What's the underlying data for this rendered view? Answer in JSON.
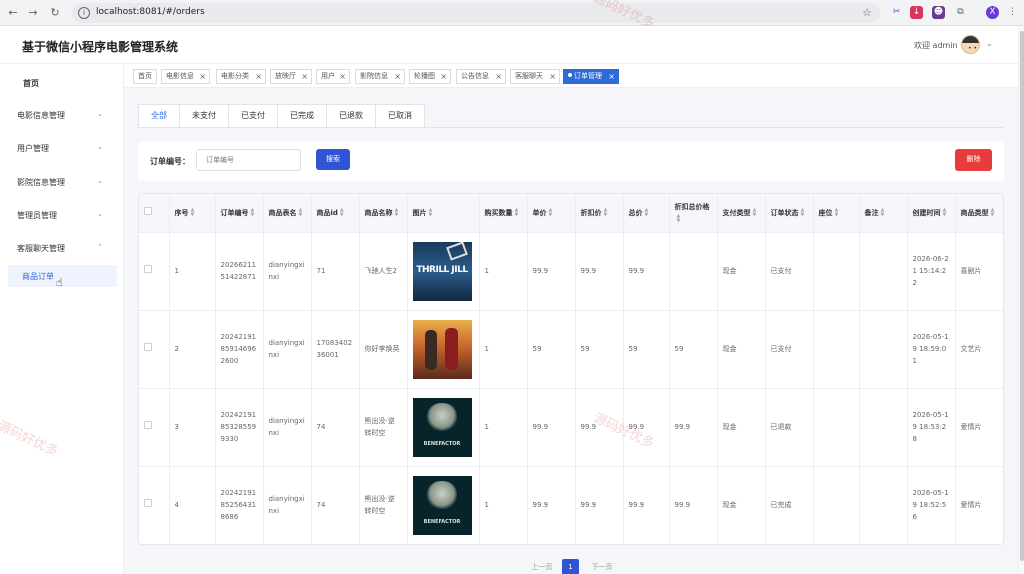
{
  "browser": {
    "url": "localhost:8081/#/orders",
    "profile_initial": "X"
  },
  "header": {
    "title": "基于微信小程序电影管理系统",
    "welcome": "欢迎 admin"
  },
  "sidebar": {
    "items": [
      {
        "label": "首页"
      },
      {
        "label": "电影信息管理"
      },
      {
        "label": "用户管理"
      },
      {
        "label": "影院信息管理"
      },
      {
        "label": "管理员管理"
      },
      {
        "label": "客服聊天管理"
      },
      {
        "label": "商品订单"
      }
    ]
  },
  "tags": [
    {
      "label": "首页"
    },
    {
      "label": "电影信息"
    },
    {
      "label": "电影分类"
    },
    {
      "label": "放映厅"
    },
    {
      "label": "用户"
    },
    {
      "label": "影院信息"
    },
    {
      "label": "轮播图"
    },
    {
      "label": "公告信息"
    },
    {
      "label": "客服聊天"
    },
    {
      "label": "订单管理"
    }
  ],
  "status_tabs": [
    {
      "label": "全部"
    },
    {
      "label": "未支付"
    },
    {
      "label": "已支付"
    },
    {
      "label": "已完成"
    },
    {
      "label": "已退款"
    },
    {
      "label": "已取消"
    }
  ],
  "search": {
    "label": "订单编号：",
    "placeholder": "订单编号",
    "search_button": "搜索",
    "delete_button": "删除"
  },
  "table": {
    "columns": [
      "序号",
      "订单编号",
      "商品表名",
      "商品id",
      "商品名称",
      "图片",
      "购买数量",
      "单价",
      "折扣价",
      "总价",
      "折扣总价格",
      "支付类型",
      "订单状态",
      "座位",
      "备注",
      "创建时间",
      "商品类型"
    ],
    "rows": [
      {
        "index": "1",
        "order_no": "2026621151422871",
        "table": "dianyingxinxi",
        "goods_id": "71",
        "name": "飞驰人生2",
        "poster": "THRILL JILL",
        "qty": "1",
        "price": "99.9",
        "discount_price": "99.9",
        "total": "99.9",
        "discount_total": "",
        "pay_type": "现金",
        "status": "已支付",
        "seat": "",
        "remark": "",
        "created": "2026-06-21 15:14:22",
        "type": "喜剧片"
      },
      {
        "index": "2",
        "order_no": "20242191859146962600",
        "table": "dianyingxinxi",
        "goods_id": "1708340236001",
        "name": "你好李焕英",
        "poster": "",
        "qty": "1",
        "price": "59",
        "discount_price": "59",
        "total": "59",
        "discount_total": "59",
        "pay_type": "现金",
        "status": "已支付",
        "seat": "",
        "remark": "",
        "created": "2026-05-19 18:59:01",
        "type": "文艺片"
      },
      {
        "index": "3",
        "order_no": "20242191853285599330",
        "table": "dianyingxinxi",
        "goods_id": "74",
        "name": "熊出没·逆转时空",
        "poster": "BENEFACTOR",
        "qty": "1",
        "price": "99.9",
        "discount_price": "99.9",
        "total": "99.9",
        "discount_total": "99.9",
        "pay_type": "现金",
        "status": "已退款",
        "seat": "",
        "remark": "",
        "created": "2026-05-19 18:53:28",
        "type": "爱情片"
      },
      {
        "index": "4",
        "order_no": "20242191852564318686",
        "table": "dianyingxinxi",
        "goods_id": "74",
        "name": "熊出没·逆转时空",
        "poster": "BENEFACTOR",
        "qty": "1",
        "price": "99.9",
        "discount_price": "99.9",
        "total": "99.9",
        "discount_total": "99.9",
        "pay_type": "现金",
        "status": "已完成",
        "seat": "",
        "remark": "",
        "created": "2026-05-19 18:52:56",
        "type": "爱情片"
      }
    ]
  },
  "pagination": {
    "prev": "上一页",
    "current": "1",
    "next": "下一页"
  },
  "watermark": "源码好优多"
}
